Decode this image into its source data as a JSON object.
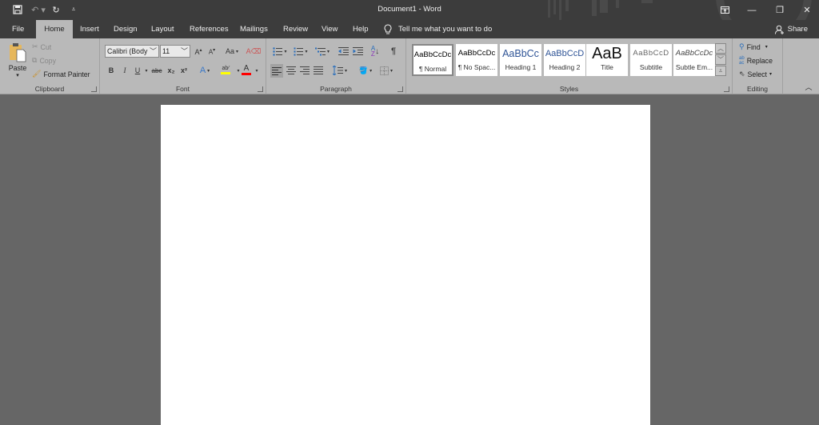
{
  "titlebar": {
    "title": "Document1  -  Word",
    "quick_access": {
      "save": "save-icon",
      "undo": "undo-icon",
      "redo": "redo-icon",
      "customize": "customize-qat-icon"
    },
    "window_buttons": {
      "ribbon_display": "ribbon-display-options-icon",
      "minimize": "minimize-icon",
      "restore": "restore-icon",
      "close": "close-icon"
    }
  },
  "tabs": [
    {
      "label": "File"
    },
    {
      "label": "Home",
      "active": true
    },
    {
      "label": "Insert"
    },
    {
      "label": "Design"
    },
    {
      "label": "Layout"
    },
    {
      "label": "References"
    },
    {
      "label": "Mailings"
    },
    {
      "label": "Review"
    },
    {
      "label": "View"
    },
    {
      "label": "Help"
    }
  ],
  "tell_me": "Tell me what you want to do",
  "share": "Share",
  "ribbon": {
    "clipboard": {
      "label": "Clipboard",
      "paste": "Paste",
      "cut": "Cut",
      "copy": "Copy",
      "format_painter": "Format Painter"
    },
    "font": {
      "label": "Font",
      "font_name": "Calibri (Body",
      "font_size": "11",
      "change_case": "Aa",
      "bold": "B",
      "italic": "I",
      "underline": "U",
      "strikethrough": "abc",
      "subscript": "x₂",
      "superscript": "x²",
      "highlight_color": "#ffff00",
      "font_color": "#ff0000"
    },
    "paragraph": {
      "label": "Paragraph",
      "show_marks": "¶"
    },
    "styles": {
      "label": "Styles",
      "items": [
        {
          "sample": "AaBbCcDc",
          "name": "¶ Normal"
        },
        {
          "sample": "AaBbCcDc",
          "name": "¶ No Spac..."
        },
        {
          "sample": "AaBbCc",
          "name": "Heading 1"
        },
        {
          "sample": "AaBbCcD",
          "name": "Heading 2"
        },
        {
          "sample": "AaB",
          "name": "Title"
        },
        {
          "sample": "AaBbCcD",
          "name": "Subtitle"
        },
        {
          "sample": "AaBbCcDc",
          "name": "Subtle Em..."
        }
      ]
    },
    "editing": {
      "label": "Editing",
      "find": "Find",
      "replace": "Replace",
      "select": "Select"
    }
  },
  "colors": {
    "titlebar": "#3c3c3c",
    "ribbon": "#b9b9b9",
    "workspace": "#666666",
    "page": "#ffffff",
    "heading_blue": "#2f5496"
  }
}
